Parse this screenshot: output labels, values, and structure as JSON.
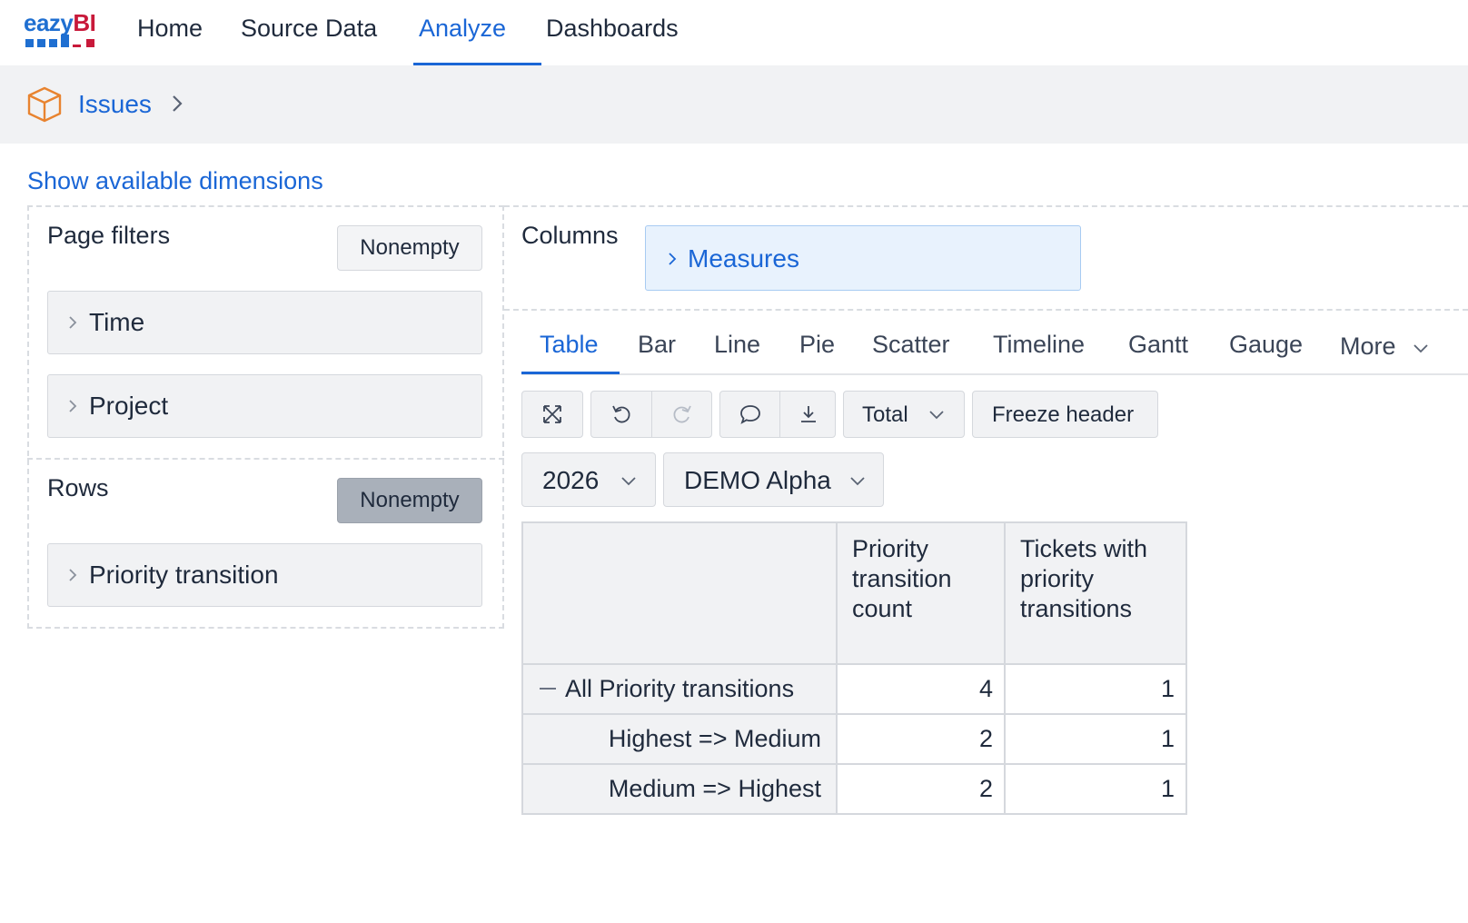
{
  "nav": {
    "logo_text": "eazy",
    "logo_accent": "BI",
    "items": [
      {
        "label": "Home",
        "active": false
      },
      {
        "label": "Source Data",
        "active": false
      },
      {
        "label": "Analyze",
        "active": true
      },
      {
        "label": "Dashboards",
        "active": false
      }
    ]
  },
  "breadcrumb": {
    "icon": "cube-icon",
    "link": "Issues"
  },
  "show_dimensions": "Show available dimensions",
  "page_filters": {
    "label": "Page filters",
    "nonempty_label": "Nonempty",
    "dimensions": [
      "Time",
      "Project"
    ]
  },
  "rows": {
    "label": "Rows",
    "nonempty_label": "Nonempty",
    "nonempty_active": true,
    "dimensions": [
      "Priority transition"
    ]
  },
  "columns": {
    "label": "Columns",
    "dimensions": [
      "Measures"
    ]
  },
  "viz_tabs": [
    "Table",
    "Bar",
    "Line",
    "Pie",
    "Scatter",
    "Timeline",
    "Gantt",
    "Gauge",
    "More"
  ],
  "active_viz_tab": "Table",
  "toolbar": {
    "total_label": "Total",
    "freeze_label": "Freeze header"
  },
  "filters": {
    "time_value": "2026",
    "project_value": "DEMO Alpha"
  },
  "table": {
    "headers": [
      "Priority transition count",
      "Tickets with priority transitions"
    ],
    "rows": [
      {
        "label": "All Priority transitions",
        "values": [
          "4",
          "1"
        ]
      },
      {
        "label": "Highest => Medium",
        "values": [
          "2",
          "1"
        ]
      },
      {
        "label": "Medium => Highest",
        "values": [
          "2",
          "1"
        ]
      }
    ]
  },
  "colors": {
    "accent": "#1a66d6",
    "brand_red": "#c8193a",
    "panel_bg": "#f1f2f4",
    "measures_bg": "#e8f2fd",
    "cube_orange": "#e8832f"
  }
}
